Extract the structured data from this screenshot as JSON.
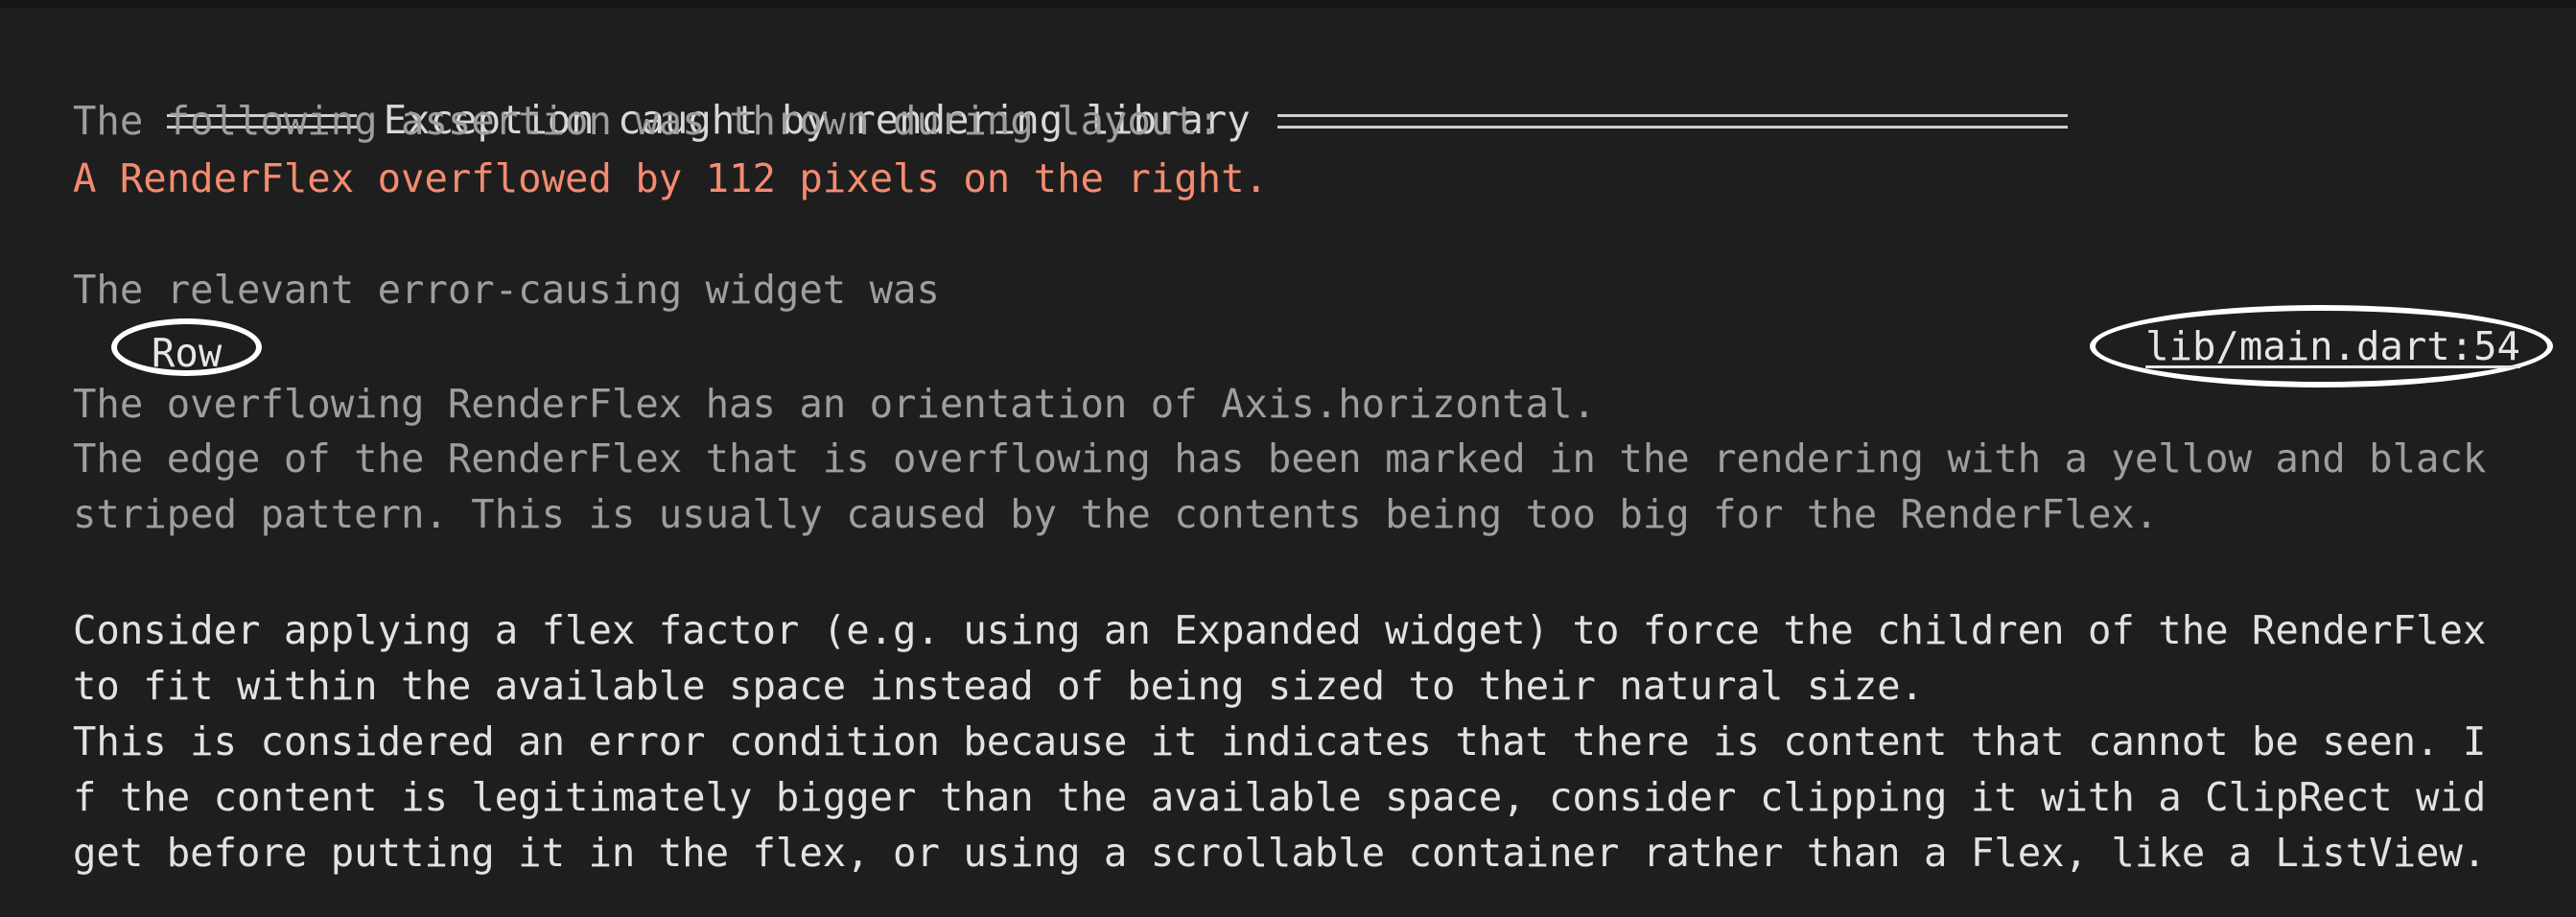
{
  "exception": {
    "header_title": "Exception caught by rendering library",
    "assertion_intro": "The following assertion was thrown during layout:",
    "error_message": "A RenderFlex overflowed by 112 pixels on the right.",
    "widget_intro": "The relevant error-causing widget was",
    "widget_name": "Row",
    "source_location": "lib/main.dart:54",
    "details": [
      "The overflowing RenderFlex has an orientation of Axis.horizontal.",
      "The edge of the RenderFlex that is overflowing has been marked in the rendering with a yellow and black",
      "striped pattern. This is usually caused by the contents being too big for the RenderFlex."
    ],
    "advice": [
      "Consider applying a flex factor (e.g. using an Expanded widget) to force the children of the RenderFlex",
      "to fit within the available space instead of being sized to their natural size.",
      "This is considered an error condition because it indicates that there is content that cannot be seen. I",
      "f the content is legitimately bigger than the available space, consider clipping it with a ClipRect wid",
      "get before putting it in the flex, or using a scrollable container rather than a Flex, like a ListView."
    ]
  },
  "colors": {
    "background": "#1e1e1e",
    "muted_text": "#9e9e9e",
    "bright_text": "#e2e2e2",
    "error_text": "#f38b70",
    "annotation": "#ffffff"
  }
}
